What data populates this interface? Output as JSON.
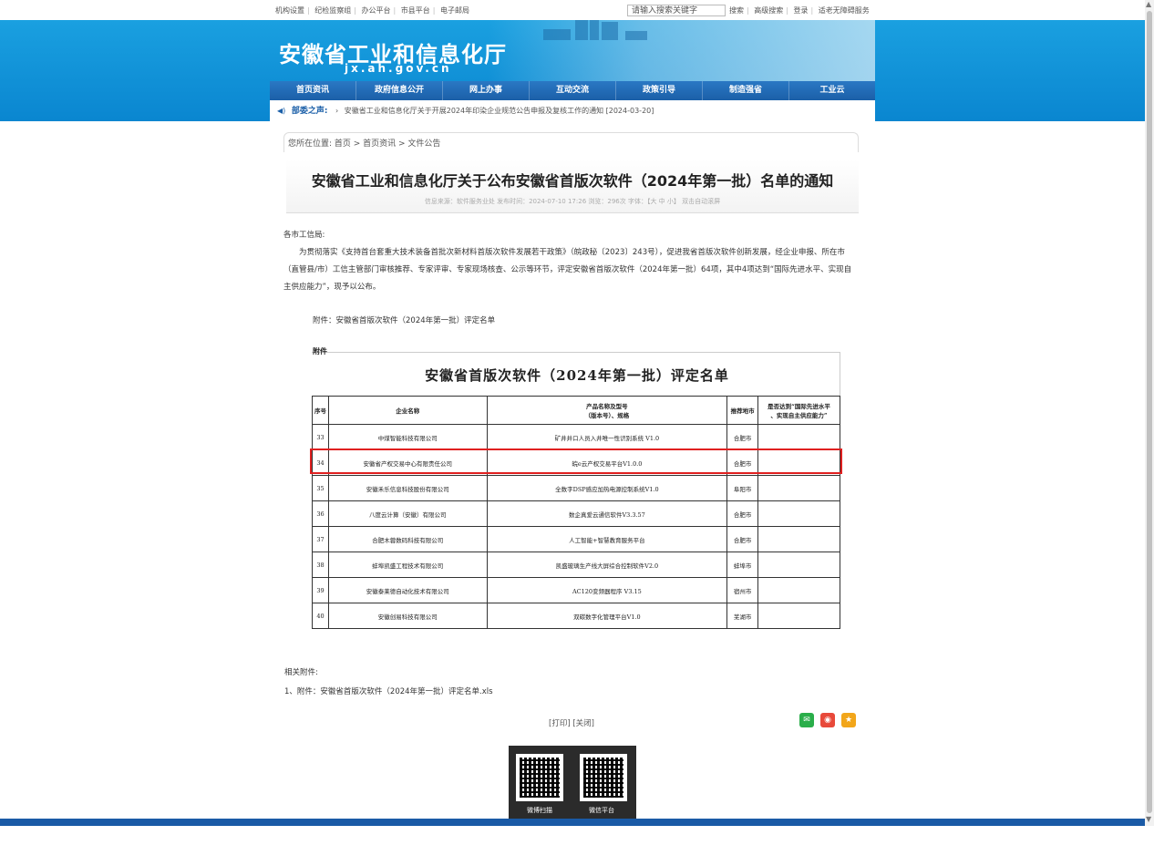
{
  "topbar": {
    "links": [
      "机构设置",
      "纪检监察组",
      "办公平台",
      "市县平台",
      "电子邮局"
    ],
    "search_placeholder": "请输入搜索关键字",
    "right_links": [
      "搜索",
      "高级搜索",
      "登录",
      "适老无障碍服务"
    ]
  },
  "header": {
    "site_title": "安徽省工业和信息化厅",
    "domain": "jx.ah.gov.cn",
    "brand_color": "#1a9ee0"
  },
  "nav": {
    "items": [
      "首页资讯",
      "政府信息公开",
      "网上办事",
      "互动交流",
      "政策引导",
      "制造强省",
      "工业云"
    ]
  },
  "notice": {
    "label": "部委之声:",
    "text": "安徽省工业和信息化厅关于开展2024年印染企业规范公告申报及复核工作的通知 [2024-03-20]"
  },
  "breadcrumb": {
    "text": "您所在位置:  首页 > 首页资讯 > 文件公告"
  },
  "article": {
    "title": "安徽省工业和信息化厅关于公布安徽省首版次软件（2024年第一批）名单的通知",
    "meta": "信息来源：软件服务业处   发布时间：2024-07-10 17:26   浏览：296次   字体：【大 中 小】   双击自动滚屏",
    "salutation": "各市工信局:",
    "body": "为贯彻落实《支持首台套重大技术装备首批次新材料首版次软件发展若干政策》（皖政秘〔2023〕243号），促进我省首版次软件创新发展，经企业申报、所在市（直管县/市）工信主管部门审核推荐、专家评审、专家现场核查、公示等环节，评定安徽省首版次软件（2024年第一批）64项，其中4项达到“国际先进水平、实现自主供应能力”，现予以公布。",
    "attachment_line": "附件：安徽省首版次软件（2024年第一批）评定名单"
  },
  "doc": {
    "label": "附件",
    "title": "安徽省首版次软件（2024年第一批）评定名单",
    "headers": [
      "序号",
      "企业名称",
      "产品名称及型号\n（版本号）、规格",
      "推荐地市",
      "是否达到“国际先进水平\n、实现自主供应能力”"
    ],
    "rows": [
      [
        "33",
        "中煤智能科技有限公司",
        "矿井井口人员入井唯一性识别系统 V1.0",
        "合肥市",
        ""
      ],
      [
        "34",
        "安徽省产权交易中心有限责任公司",
        "皖e云产权交易平台V1.0.0",
        "合肥市",
        ""
      ],
      [
        "35",
        "安徽禾乐信息科技股份有限公司",
        "全数字DSP感应加热电源控制系统V1.0",
        "阜阳市",
        ""
      ],
      [
        "36",
        "八度云计算（安徽）有限公司",
        "数企真爱云通信软件V3.3.57",
        "合肥市",
        ""
      ],
      [
        "37",
        "合肥木蓉数码科技有限公司",
        "人工智能+智慧教育服务平台",
        "合肥市",
        ""
      ],
      [
        "38",
        "蚌埠凯盛工程技术有限公司",
        "凯盛玻璃生产线大屏综合控制软件V2.0",
        "蚌埠市",
        ""
      ],
      [
        "39",
        "安徽泰莱德自动化技术有限公司",
        "AC120变频器程序 V3.15",
        "宿州市",
        ""
      ],
      [
        "40",
        "安徽创易科技有限公司",
        "双碳数字化管理平台V1.0",
        "芜湖市",
        ""
      ]
    ],
    "highlight_color": "#e02020"
  },
  "related": {
    "title": "相关附件:",
    "file": "1、附件：安徽省首版次软件（2024年第一批）评定名单.xls"
  },
  "actions": {
    "print": "[打印] [关闭]",
    "share_icons": [
      "wechat-icon",
      "weibo-icon",
      "favorite-icon"
    ]
  },
  "qr": {
    "left_label": "微博扫描",
    "right_label": "微信平台"
  }
}
